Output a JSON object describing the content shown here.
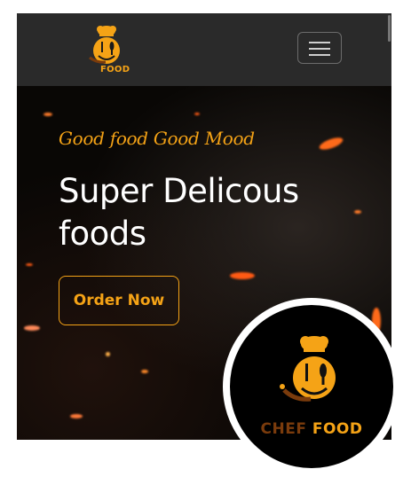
{
  "navbar": {
    "logo": {
      "icon": "chef-food-logo-icon",
      "brand_prefix": "",
      "brand_word": "FOOD",
      "accent_color": "#f5a316",
      "dark_color": "#7a3b0c"
    },
    "toggler": {
      "icon": "hamburger-menu-icon"
    }
  },
  "hero": {
    "tagline": "Good food Good Mood",
    "headline": "Super Delicous foods",
    "cta_label": "Order Now",
    "accent_color": "#f5a316",
    "background": "embers-video"
  },
  "badge": {
    "icon": "chef-food-logo-icon",
    "brand_prefix": "CHEF",
    "brand_word": "FOOD"
  }
}
